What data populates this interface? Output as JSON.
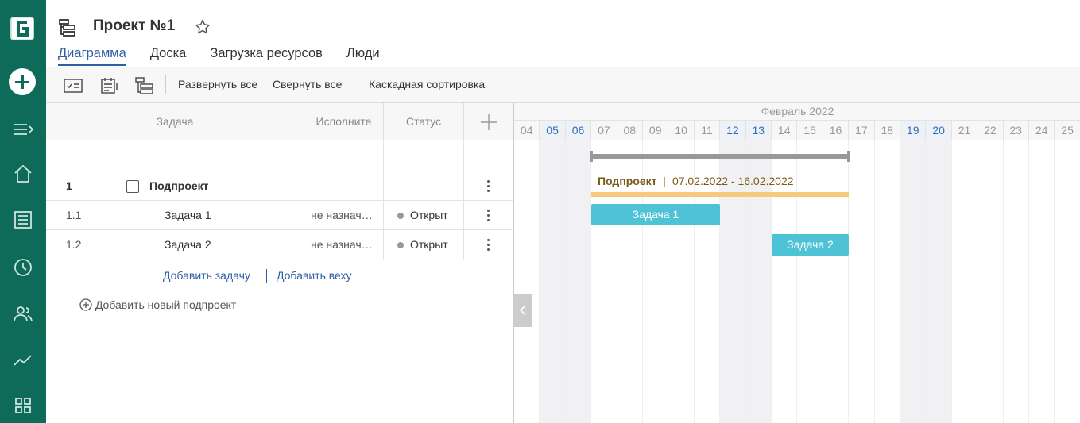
{
  "app": {
    "brand_letter": "G"
  },
  "project": {
    "title": "Проект №1"
  },
  "tabs": [
    "Диаграмма",
    "Доска",
    "Загрузка ресурсов",
    "Люди"
  ],
  "toolbar": {
    "expand_all": "Развернуть все",
    "collapse_all": "Свернуть все",
    "cascade_sort": "Каскадная сортировка"
  },
  "grid": {
    "columns": {
      "task": "Задача",
      "assignee": "Исполните",
      "status": "Статус"
    },
    "rows": [
      {
        "num": "1",
        "name": "Подпроект",
        "assignee": "",
        "status": ""
      },
      {
        "num": "1.1",
        "name": "Задача 1",
        "assignee": "не назнач…",
        "status": "Открыт"
      },
      {
        "num": "1.2",
        "name": "Задача 2",
        "assignee": "не назнач…",
        "status": "Открыт"
      }
    ],
    "add_task": "Добавить задачу",
    "add_milestone": "Добавить веху",
    "add_subproject": "Добавить новый подпроект"
  },
  "chart": {
    "month": "Февраль 2022",
    "days": [
      "04",
      "05",
      "06",
      "07",
      "08",
      "09",
      "10",
      "11",
      "12",
      "13",
      "14",
      "15",
      "16",
      "17",
      "18",
      "19",
      "20",
      "21",
      "22",
      "23",
      "24",
      "25"
    ],
    "weekend_days": [
      "05",
      "06",
      "12",
      "13",
      "19",
      "20"
    ],
    "subproject_label": "Подпроект",
    "subproject_dates": "07.02.2022 - 16.02.2022",
    "task1_label": "Задача 1",
    "task2_label": "Задача 2"
  },
  "colors": {
    "rail": "#0e6b5a",
    "accent": "#2f5fa5",
    "bar": "#4fc3d6",
    "subproject_bar": "#f8c97a",
    "summary_bar": "#999999"
  }
}
